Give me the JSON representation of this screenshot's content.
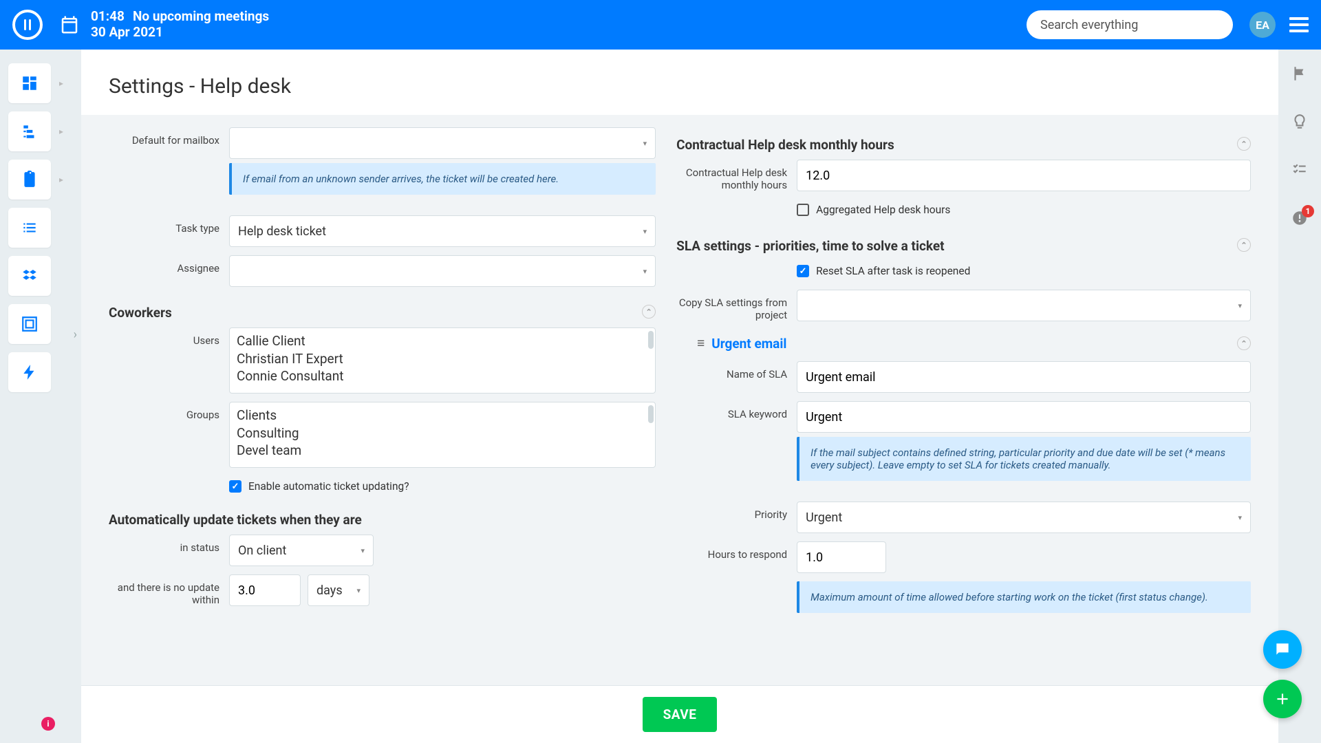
{
  "header": {
    "time": "01:48",
    "meeting_status": "No upcoming meetings",
    "date": "30 Apr 2021",
    "search_placeholder": "Search everything",
    "avatar": "EA"
  },
  "right_pane": {
    "bell_count": "1"
  },
  "page_title": "Settings - Help desk",
  "left": {
    "default_mailbox_label": "Default for mailbox",
    "default_mailbox_value": "",
    "info1": "If email from an unknown sender arrives, the ticket will be created here.",
    "task_type_label": "Task type",
    "task_type_value": "Help desk ticket",
    "assignee_label": "Assignee",
    "coworkers_heading": "Coworkers",
    "users_label": "Users",
    "users": [
      "Callie Client",
      "Christian IT Expert",
      "Connie Consultant"
    ],
    "groups_label": "Groups",
    "groups": [
      "Clients",
      "Consulting",
      "Devel team"
    ],
    "enable_auto_label": "Enable automatic ticket updating?",
    "auto_heading": "Automatically update tickets when they are",
    "in_status_label": "in status",
    "in_status_value": "On client",
    "no_update_label": "and there is no update within",
    "no_update_value": "3.0",
    "no_update_unit": "days"
  },
  "right": {
    "hours_heading": "Contractual Help desk monthly hours",
    "hours_label": "Contractual Help desk monthly hours",
    "hours_value": "12.0",
    "aggregated_label": "Aggregated Help desk hours",
    "sla_heading": "SLA settings - priorities, time to solve a ticket",
    "reset_sla_label": "Reset SLA after task is reopened",
    "copy_sla_label": "Copy SLA settings from project",
    "urgent_title": "Urgent email",
    "name_sla_label": "Name of SLA",
    "name_sla_value": "Urgent email",
    "sla_keyword_label": "SLA keyword",
    "sla_keyword_value": "Urgent",
    "info2": "If the mail subject contains defined string, particular priority and due date will be set (* means every subject). Leave empty to set SLA for tickets created manually.",
    "priority_label": "Priority",
    "priority_value": "Urgent",
    "respond_label": "Hours to respond",
    "respond_value": "1.0",
    "info3": "Maximum amount of time allowed before starting work on the ticket (first status change)."
  },
  "save_label": "SAVE"
}
